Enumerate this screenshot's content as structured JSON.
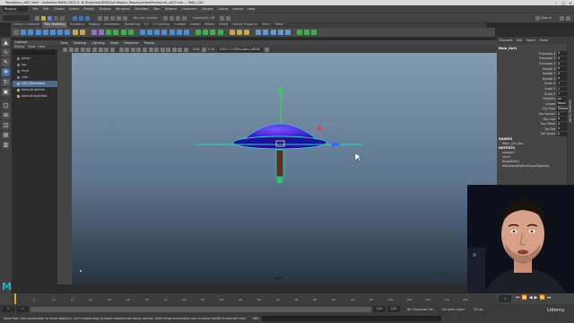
{
  "window": {
    "title": "Pendulum_v007.mb* - Autodesk MAYA 2022.3: D:\\Projects\\UDM\\Grundlagen_Maya\\scenes\\Pendulum_v007.mb   ---   Main_Ctrl",
    "controls": [
      "–",
      "□",
      "×"
    ]
  },
  "menubar": {
    "mode": "Rigging",
    "items": [
      "File",
      "Edit",
      "Create",
      "Select",
      "Modify",
      "Display",
      "Windows",
      "Skeleton",
      "Skin",
      "Deform",
      "Constrain",
      "Control",
      "Cache",
      "Arnold",
      "Help"
    ]
  },
  "statusline": {
    "live_surface": "No Live Surface",
    "symmetry": "Symmetry: Off",
    "sign_in": "Sign In"
  },
  "shelf": {
    "tabs": [
      "Curves / Surfaces",
      "Poly Modeling",
      "Sculpting",
      "Rigging",
      "Animation",
      "Rendering",
      "FX",
      "FX Caching",
      "Custom",
      "Arnold",
      "Bifrost",
      "MASH",
      "Motion Graphics",
      "XGen",
      "Turtle"
    ],
    "active_tab": "Poly Modeling"
  },
  "outliner": {
    "title": "Outliner",
    "menu": [
      "Display",
      "Show",
      "Help"
    ],
    "items": [
      {
        "label": "persp",
        "selected": false
      },
      {
        "label": "top",
        "selected": false
      },
      {
        "label": "front",
        "selected": false
      },
      {
        "label": "side",
        "selected": false
      },
      {
        "label": "GEO_Pendulum",
        "selected": true
      },
      {
        "label": "defaultLightSet",
        "selected": false
      },
      {
        "label": "defaultObjectSet",
        "selected": false
      }
    ]
  },
  "viewport": {
    "menu": [
      "View",
      "Shading",
      "Lighting",
      "Show",
      "Renderer",
      "Panels"
    ],
    "colorspace": "ACES 1.0 SDR-video (sRGB)",
    "exposure": "0.00",
    "gamma": "1.00",
    "camera_label": "left ▾",
    "fps_label": "Frame:"
  },
  "channelbox": {
    "tabs": [
      "Channels",
      "Edit",
      "Object",
      "Show"
    ],
    "object_name": "Main_Ctrl1",
    "attributes": [
      {
        "label": "Translate X",
        "value": "0"
      },
      {
        "label": "Translate Y",
        "value": "0"
      },
      {
        "label": "Translate Z",
        "value": "0"
      },
      {
        "label": "Rotate X",
        "value": "0"
      },
      {
        "label": "Rotate Y",
        "value": "0"
      },
      {
        "label": "Rotate Z",
        "value": "0"
      },
      {
        "label": "Scale X",
        "value": "1"
      },
      {
        "label": "Scale Y",
        "value": "1"
      },
      {
        "label": "Scale Z",
        "value": "1"
      },
      {
        "label": "Visibility",
        "value": "on"
      },
      {
        "label": "Create",
        "value": "None Roll"
      },
      {
        "label": "Rig Type",
        "value": "Simple"
      },
      {
        "label": "Top Squash",
        "value": "0"
      },
      {
        "label": "Top Size",
        "value": "0"
      },
      {
        "label": "Top Offset",
        "value": "0"
      },
      {
        "label": "Top Rot",
        "value": "0"
      },
      {
        "label": "Tail Space",
        "value": "0"
      }
    ],
    "shapes_header": "SHAPES",
    "shapes": [
      "Main_Ctrl_shp"
    ],
    "outputs_header": "OUTPUTS",
    "outputs": [
      "squash1",
      "skin1",
      "BodyMath1",
      "MayaNodeEditorSavedTabsInfo"
    ],
    "side_tabs": [
      "Attribute Editor",
      "Channel Box / Layer Editor",
      "Modeling Toolkit",
      "Tool Settings"
    ]
  },
  "timeline": {
    "ticks": [
      "1",
      "5",
      "10",
      "15",
      "20",
      "25",
      "30",
      "35",
      "40",
      "45",
      "50",
      "55",
      "60",
      "65",
      "70",
      "75",
      "80",
      "85",
      "90",
      "95",
      "100",
      "105",
      "110",
      "115",
      "120"
    ],
    "current_frame": "1"
  },
  "rangebar": {
    "start": "1",
    "range_start": "1",
    "range_end": "120",
    "end": "120",
    "character_set": "No Character Set",
    "anim_layer": "No Anim Layer",
    "fps": "24 fps"
  },
  "helpline": {
    "mel_label": "MEL",
    "text": "Move Tool: Use manipulator to move object(s). Ctrl+middle-drag to move components along normals. Shift+drag manipulator axis or plane handle to extrude components or clone objects."
  },
  "watermark": "Udemy",
  "maya_logo": "M",
  "colors": {
    "selection_cyan": "#26d8c0",
    "mesh_purple": "#4a22e0",
    "channel_highlight": "#4e6b8c"
  }
}
